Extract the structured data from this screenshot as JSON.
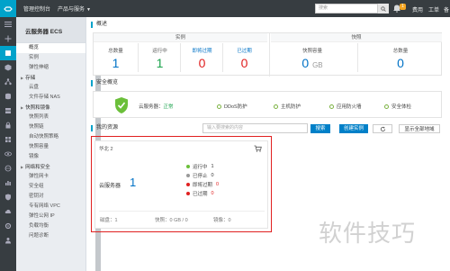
{
  "topbar": {
    "console_label": "管理控制台",
    "products_label": "产品与服务",
    "search_placeholder": "搜索",
    "notification_count": "1",
    "billing_label": "费用",
    "ticket_label": "工单",
    "record_label": "备"
  },
  "sidebar": {
    "title": "云服务器 ECS",
    "items": [
      {
        "label": "概览",
        "type": "item",
        "selected": true
      },
      {
        "label": "实例",
        "type": "item"
      },
      {
        "label": "弹性伸缩",
        "type": "item"
      },
      {
        "label": "存储",
        "type": "group"
      },
      {
        "label": "云盘",
        "type": "item"
      },
      {
        "label": "文件存储 NAS",
        "type": "item"
      },
      {
        "label": "快照和镜像",
        "type": "group"
      },
      {
        "label": "快照列表",
        "type": "item"
      },
      {
        "label": "快照链",
        "type": "item"
      },
      {
        "label": "自动快照策略",
        "type": "item"
      },
      {
        "label": "快照容量",
        "type": "item"
      },
      {
        "label": "镜像",
        "type": "item"
      },
      {
        "label": "网络和安全",
        "type": "group"
      },
      {
        "label": "弹性网卡",
        "type": "item"
      },
      {
        "label": "安全组",
        "type": "item"
      },
      {
        "label": "密钥对",
        "type": "item"
      },
      {
        "label": "专有网络 VPC",
        "type": "item"
      },
      {
        "label": "弹性公网 IP",
        "type": "item"
      },
      {
        "label": "负载均衡",
        "type": "item"
      },
      {
        "label": "问题诊断",
        "type": "item"
      }
    ]
  },
  "overview": {
    "section_title": "概述",
    "instance_header": "实例",
    "snapshot_header": "快照",
    "stats": [
      {
        "label": "总数量",
        "value": "1",
        "color": "#0072c6"
      },
      {
        "label": "运行中",
        "value": "1",
        "color": "#1aa24c"
      },
      {
        "label": "即将过期",
        "value": "0",
        "color": "#e02020"
      },
      {
        "label": "已过期",
        "value": "0",
        "color": "#e02020"
      }
    ],
    "snapshot_stats": [
      {
        "label": "快照容量",
        "value": "0",
        "unit": "GB"
      },
      {
        "label": "总数量",
        "value": "0",
        "unit": ""
      }
    ]
  },
  "security": {
    "section_title": "安全概览",
    "server_label": "云服务器：",
    "server_status": "正常",
    "items": [
      "DDoS防护",
      "主机防护",
      "应用防火墙",
      "安全体检"
    ]
  },
  "resources": {
    "section_title": "我的资源",
    "search_placeholder": "输入要搜索的内容",
    "search_btn": "搜索",
    "create_btn": "创建实例",
    "show_all_btn": "显示全部地域",
    "region": "华北 2",
    "server_label": "云服务器",
    "server_count": "1",
    "legend": [
      {
        "label": "运行中",
        "value": "1",
        "color": "#6bbf3a"
      },
      {
        "label": "已停止",
        "value": "0",
        "color": "#999999"
      },
      {
        "label": "即将过期",
        "value": "0",
        "color": "#e02020"
      },
      {
        "label": "已过期",
        "value": "0",
        "color": "#e02020"
      }
    ],
    "footer": [
      {
        "label": "磁盘：1"
      },
      {
        "label": "快照：0 GB / 0"
      },
      {
        "label": "镜像：0"
      }
    ]
  },
  "watermark": "软件技巧"
}
